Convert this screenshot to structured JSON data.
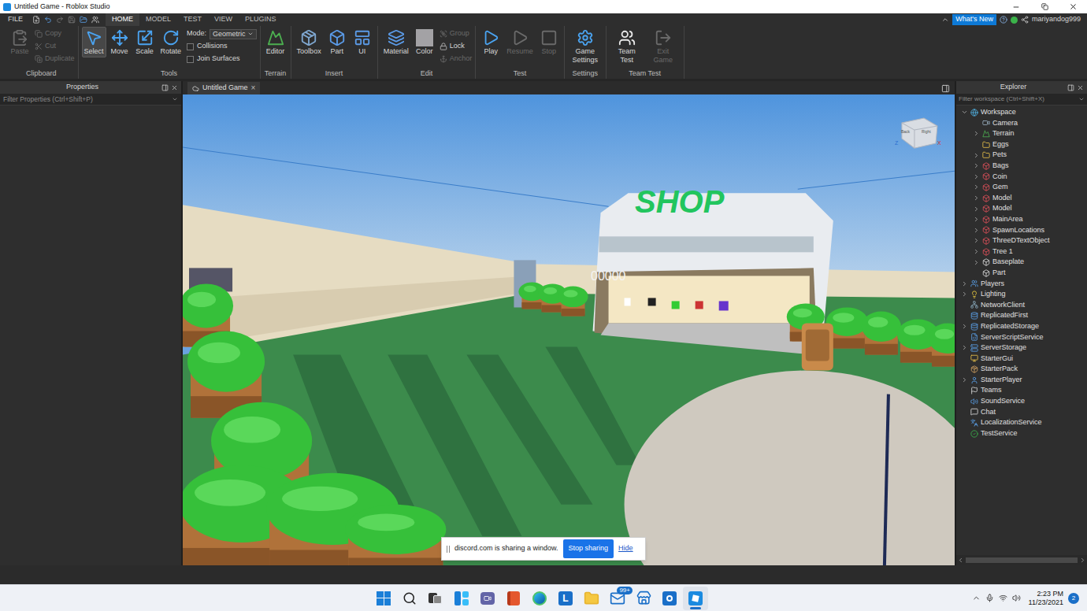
{
  "window": {
    "title": "Untitled Game - Roblox Studio"
  },
  "menu": {
    "file": "FILE",
    "tabs": [
      {
        "label": "HOME",
        "selected": true
      },
      {
        "label": "MODEL",
        "selected": false
      },
      {
        "label": "TEST",
        "selected": false
      },
      {
        "label": "VIEW",
        "selected": false
      },
      {
        "label": "PLUGINS",
        "selected": false
      }
    ],
    "whats_new": "What's New",
    "user": "mariyandog999"
  },
  "ribbon": {
    "groups": [
      {
        "label": "Clipboard",
        "items": [
          {
            "label": "Paste",
            "kind": "large",
            "disabled": true,
            "selected": false
          },
          {
            "label": "Copy",
            "kind": "small",
            "disabled": true,
            "selected": false
          },
          {
            "label": "Cut",
            "kind": "small",
            "disabled": true,
            "selected": false
          },
          {
            "label": "Duplicate",
            "kind": "small",
            "disabled": true,
            "selected": false
          }
        ]
      },
      {
        "label": "Tools",
        "items": [
          {
            "label": "Select",
            "kind": "large",
            "disabled": false,
            "selected": true
          },
          {
            "label": "Move",
            "kind": "large",
            "disabled": false,
            "selected": false
          },
          {
            "label": "Scale",
            "kind": "large",
            "disabled": false,
            "selected": false
          },
          {
            "label": "Rotate",
            "kind": "large",
            "disabled": false,
            "selected": false
          },
          {
            "label": "Mode:",
            "kind": "dropdown",
            "value": "Geometric",
            "disabled": false,
            "selected": false
          },
          {
            "label": "Collisions",
            "kind": "checkbox",
            "checked": false,
            "disabled": false,
            "selected": false
          },
          {
            "label": "Join Surfaces",
            "kind": "checkbox",
            "checked": false,
            "disabled": false,
            "selected": false
          }
        ]
      },
      {
        "label": "Terrain",
        "items": [
          {
            "label": "Editor",
            "kind": "large",
            "disabled": false,
            "selected": false
          }
        ]
      },
      {
        "label": "Insert",
        "items": [
          {
            "label": "Toolbox",
            "kind": "large",
            "disabled": false,
            "selected": false
          },
          {
            "label": "Part",
            "kind": "large",
            "disabled": false,
            "selected": false
          },
          {
            "label": "UI",
            "kind": "large",
            "disabled": false,
            "selected": false
          }
        ]
      },
      {
        "label": "Edit",
        "items": [
          {
            "label": "Material",
            "kind": "large",
            "disabled": false,
            "selected": false
          },
          {
            "label": "Color",
            "kind": "large",
            "disabled": false,
            "selected": false
          },
          {
            "label": "Group",
            "kind": "small",
            "disabled": true,
            "selected": false
          },
          {
            "label": "Lock",
            "kind": "small",
            "disabled": false,
            "selected": false
          },
          {
            "label": "Anchor",
            "kind": "small",
            "disabled": true,
            "selected": false
          }
        ]
      },
      {
        "label": "Test",
        "items": [
          {
            "label": "Play",
            "kind": "large",
            "disabled": false,
            "selected": false
          },
          {
            "label": "Resume",
            "kind": "large",
            "disabled": true,
            "selected": false
          },
          {
            "label": "Stop",
            "kind": "large",
            "disabled": true,
            "selected": false
          }
        ]
      },
      {
        "label": "Settings",
        "items": [
          {
            "label": "Game Settings",
            "kind": "large",
            "disabled": false,
            "selected": false
          }
        ]
      },
      {
        "label": "Team Test",
        "items": [
          {
            "label": "Team Test",
            "kind": "large",
            "disabled": false,
            "selected": false
          },
          {
            "label": "Exit Game",
            "kind": "large",
            "disabled": true,
            "selected": false
          }
        ]
      }
    ]
  },
  "properties": {
    "title": "Properties",
    "filter": "Filter Properties (Ctrl+Shift+P)"
  },
  "viewport": {
    "tab": "Untitled Game",
    "close": "×",
    "sign": "SHOP",
    "counter": "00000",
    "viewcube": {
      "faces": [
        "Back",
        "Right"
      ],
      "axes": [
        "Z",
        "X"
      ]
    }
  },
  "explorer": {
    "title": "Explorer",
    "filter": "Filter workspace (Ctrl+Shift+X)",
    "items": [
      {
        "name": "Workspace",
        "kind": "workspace",
        "depth": 0,
        "expandable": true,
        "expanded": true
      },
      {
        "name": "Camera",
        "kind": "camera",
        "depth": 1,
        "expandable": false,
        "expanded": false
      },
      {
        "name": "Terrain",
        "kind": "terrain",
        "depth": 1,
        "expandable": true,
        "expanded": false
      },
      {
        "name": "Eggs",
        "kind": "folder",
        "depth": 1,
        "expandable": false,
        "expanded": false
      },
      {
        "name": "Pets",
        "kind": "folder",
        "depth": 1,
        "expandable": true,
        "expanded": false
      },
      {
        "name": "Bags",
        "kind": "model",
        "depth": 1,
        "expandable": true,
        "expanded": false
      },
      {
        "name": "Coin",
        "kind": "model",
        "depth": 1,
        "expandable": true,
        "expanded": false
      },
      {
        "name": "Gem",
        "kind": "model",
        "depth": 1,
        "expandable": true,
        "expanded": false
      },
      {
        "name": "Model",
        "kind": "model",
        "depth": 1,
        "expandable": true,
        "expanded": false
      },
      {
        "name": "Model",
        "kind": "model",
        "depth": 1,
        "expandable": true,
        "expanded": false
      },
      {
        "name": "MainArea",
        "kind": "model",
        "depth": 1,
        "expandable": true,
        "expanded": false
      },
      {
        "name": "SpawnLocations",
        "kind": "model",
        "depth": 1,
        "expandable": true,
        "expanded": false
      },
      {
        "name": "ThreeDTextObject",
        "kind": "model",
        "depth": 1,
        "expandable": true,
        "expanded": false
      },
      {
        "name": "Tree 1",
        "kind": "model",
        "depth": 1,
        "expandable": true,
        "expanded": false
      },
      {
        "name": "Baseplate",
        "kind": "part",
        "depth": 1,
        "expandable": true,
        "expanded": false
      },
      {
        "name": "Part",
        "kind": "part",
        "depth": 1,
        "expandable": false,
        "expanded": false
      },
      {
        "name": "Players",
        "kind": "players",
        "depth": 0,
        "expandable": true,
        "expanded": false
      },
      {
        "name": "Lighting",
        "kind": "lighting",
        "depth": 0,
        "expandable": true,
        "expanded": false
      },
      {
        "name": "NetworkClient",
        "kind": "network",
        "depth": 0,
        "expandable": false,
        "expanded": false
      },
      {
        "name": "ReplicatedFirst",
        "kind": "replicated",
        "depth": 0,
        "expandable": false,
        "expanded": false
      },
      {
        "name": "ReplicatedStorage",
        "kind": "replicated",
        "depth": 0,
        "expandable": true,
        "expanded": false
      },
      {
        "name": "ServerScriptService",
        "kind": "script",
        "depth": 0,
        "expandable": false,
        "expanded": false
      },
      {
        "name": "ServerStorage",
        "kind": "storage",
        "depth": 0,
        "expandable": true,
        "expanded": false
      },
      {
        "name": "StarterGui",
        "kind": "gui",
        "depth": 0,
        "expandable": false,
        "expanded": false
      },
      {
        "name": "StarterPack",
        "kind": "pack",
        "depth": 0,
        "expandable": false,
        "expanded": false
      },
      {
        "name": "StarterPlayer",
        "kind": "player",
        "depth": 0,
        "expandable": true,
        "expanded": false
      },
      {
        "name": "Teams",
        "kind": "teams",
        "depth": 0,
        "expandable": false,
        "expanded": false
      },
      {
        "name": "SoundService",
        "kind": "sound",
        "depth": 0,
        "expandable": false,
        "expanded": false
      },
      {
        "name": "Chat",
        "kind": "chat",
        "depth": 0,
        "expandable": false,
        "expanded": false
      },
      {
        "name": "LocalizationService",
        "kind": "localization",
        "depth": 0,
        "expandable": false,
        "expanded": false
      },
      {
        "name": "TestService",
        "kind": "test",
        "depth": 0,
        "expandable": false,
        "expanded": false
      }
    ]
  },
  "discord": {
    "message": "discord.com is sharing a window.",
    "stop": "Stop sharing",
    "hide": "Hide"
  },
  "taskbar": {
    "apps": [
      {
        "kind": "start",
        "selected": false
      },
      {
        "kind": "search",
        "selected": false
      },
      {
        "kind": "taskview",
        "selected": false
      },
      {
        "kind": "widgets",
        "selected": false
      },
      {
        "kind": "chat",
        "selected": false
      },
      {
        "kind": "office",
        "selected": false
      },
      {
        "kind": "edge",
        "selected": false
      },
      {
        "kind": "letter",
        "glyph": "L",
        "selected": false
      },
      {
        "kind": "explorer",
        "selected": false
      },
      {
        "kind": "mail",
        "badge": "99+",
        "selected": false
      },
      {
        "kind": "store",
        "selected": false
      },
      {
        "kind": "app",
        "selected": false
      },
      {
        "kind": "studio",
        "selected": true
      }
    ],
    "time": "2:23 PM",
    "date": "11/23/2021",
    "notifications": "2"
  }
}
